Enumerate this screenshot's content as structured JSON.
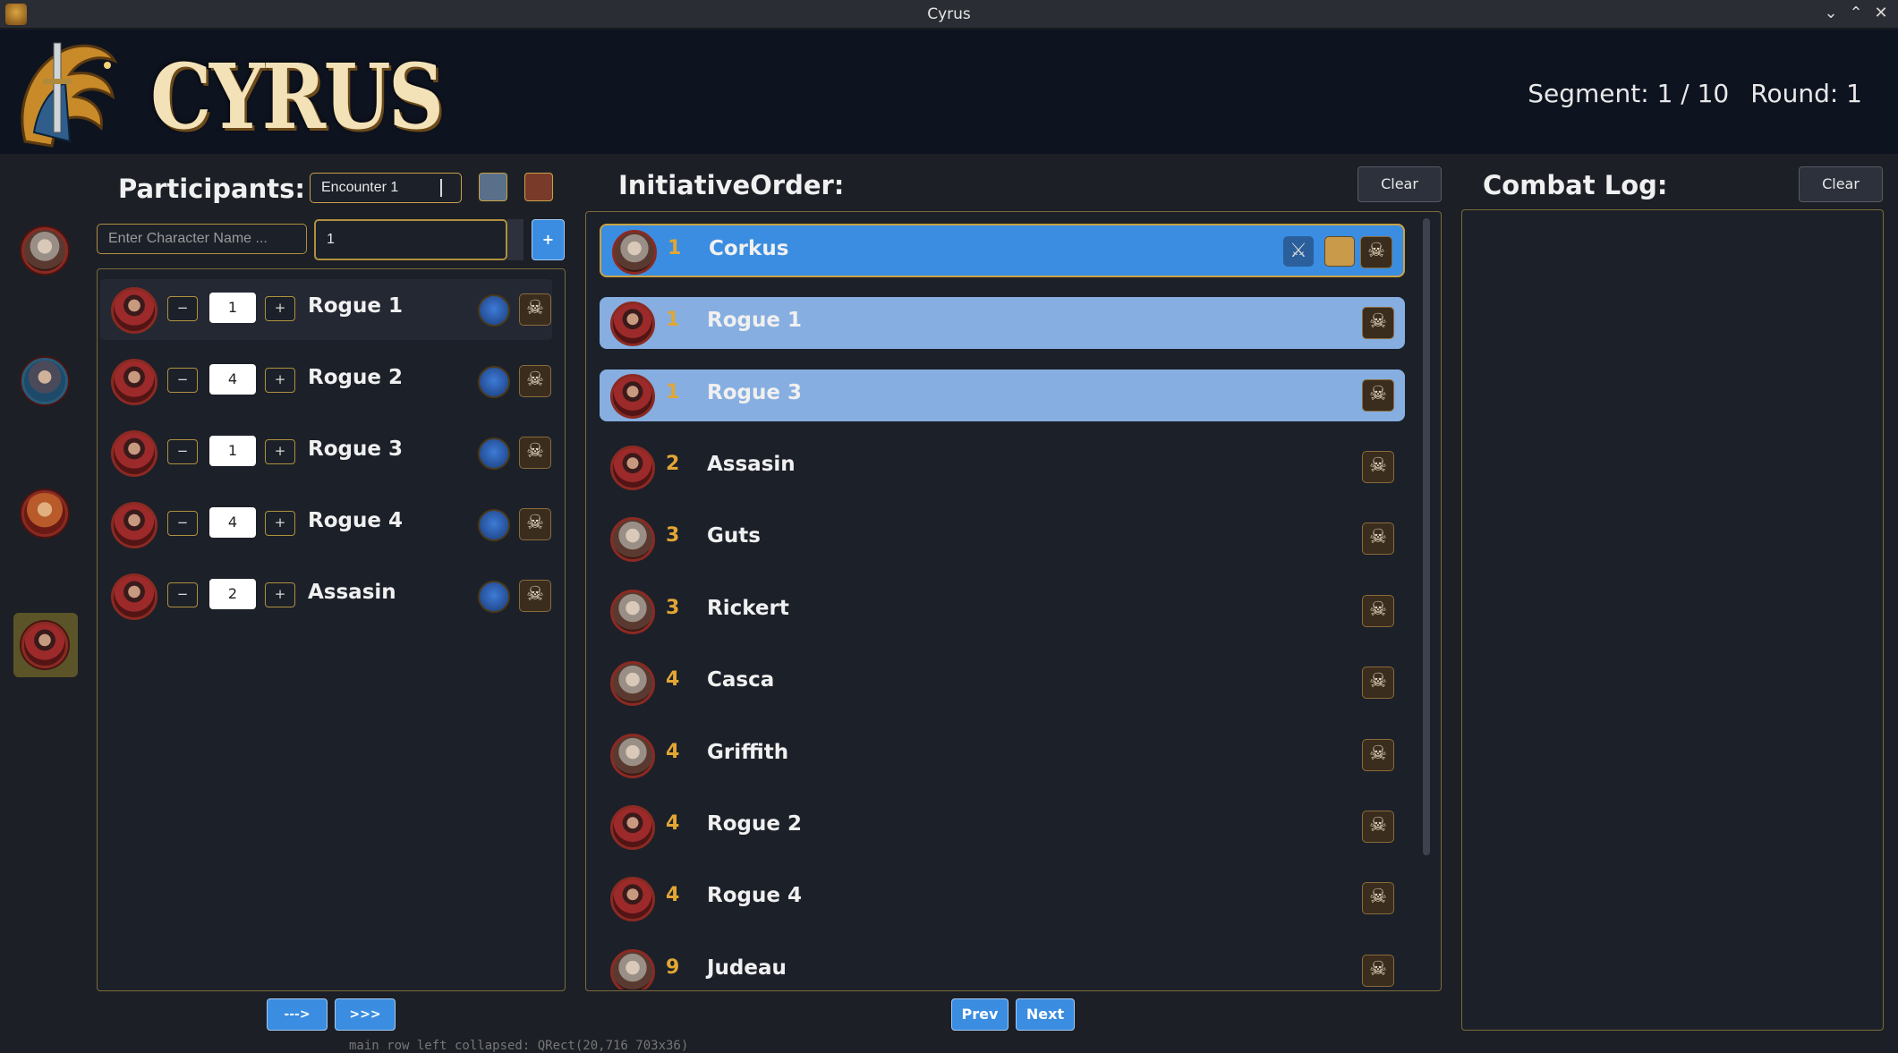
{
  "window": {
    "title": "Cyrus"
  },
  "header": {
    "logo_text": "CYRUS",
    "segment": "Segment: 1 / 10",
    "round": "Round: 1"
  },
  "participants": {
    "heading": "Participants:",
    "encounter_value": "Encounter 1",
    "name_placeholder": "Enter Character Name ...",
    "count_value": "1",
    "add_label": "+",
    "rows": [
      {
        "name": "Rogue 1",
        "qty": "1"
      },
      {
        "name": "Rogue 2",
        "qty": "4"
      },
      {
        "name": "Rogue 3",
        "qty": "1"
      },
      {
        "name": "Rogue 4",
        "qty": "4"
      },
      {
        "name": "Assasin",
        "qty": "2"
      }
    ],
    "minus_label": "−",
    "plus_label": "+",
    "next_label": "--->",
    "all_label": ">>>"
  },
  "initiative": {
    "heading": "InitiativeOrder:",
    "clear_label": "Clear",
    "prev_label": "Prev",
    "next_label": "Next",
    "rows": [
      {
        "num": "1",
        "name": "Corkus"
      },
      {
        "num": "1",
        "name": "Rogue 1"
      },
      {
        "num": "1",
        "name": "Rogue 3"
      },
      {
        "num": "2",
        "name": "Assasin"
      },
      {
        "num": "3",
        "name": "Guts"
      },
      {
        "num": "3",
        "name": "Rickert"
      },
      {
        "num": "4",
        "name": "Casca"
      },
      {
        "num": "4",
        "name": "Griffith"
      },
      {
        "num": "4",
        "name": "Rogue 2"
      },
      {
        "num": "4",
        "name": "Rogue 4"
      },
      {
        "num": "9",
        "name": "Judeau"
      }
    ]
  },
  "combat_log": {
    "heading": "Combat Log:",
    "clear_label": "Clear"
  },
  "skull_glyph": "☠",
  "debug_text": "main row left collapsed: QRect(20,716 703x36)"
}
